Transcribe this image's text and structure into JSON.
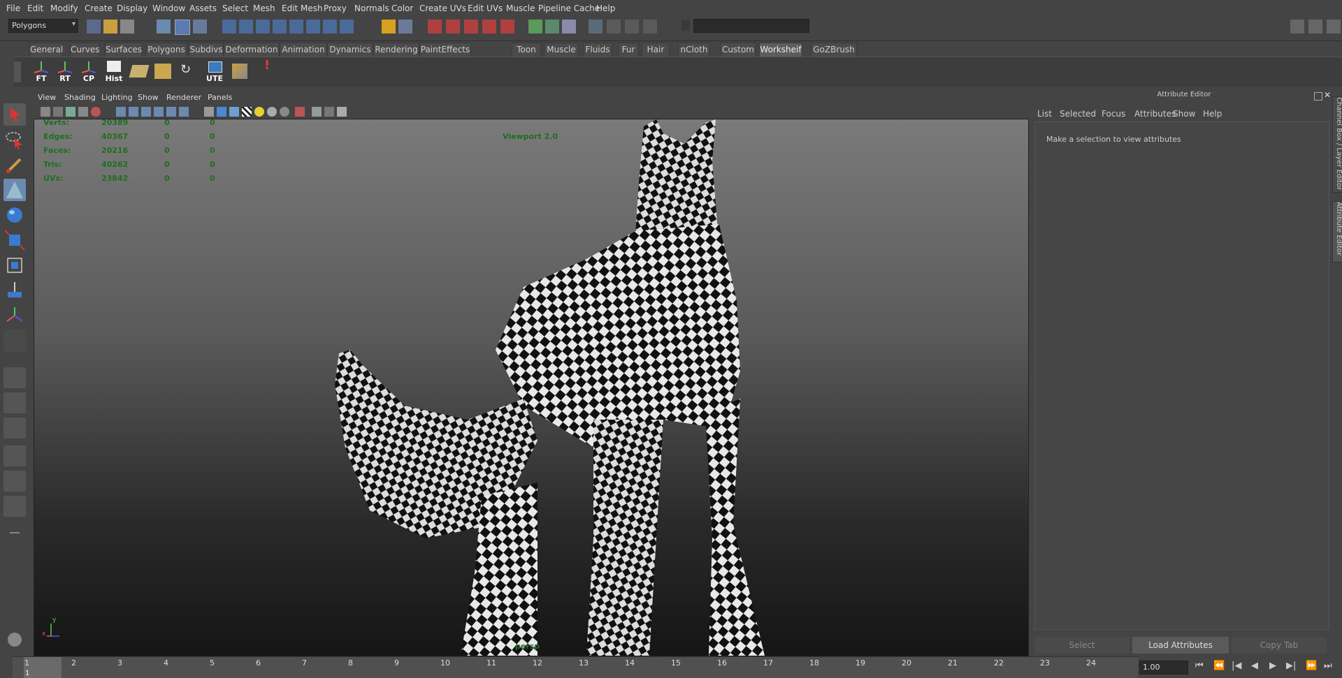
{
  "menubar": {
    "items": [
      "File",
      "Edit",
      "Modify",
      "Create",
      "Display",
      "Window",
      "Assets",
      "Select",
      "Mesh",
      "Edit Mesh",
      "Proxy",
      "Normals",
      "Color",
      "Create UVs",
      "Edit UVs",
      "Muscle",
      "Pipeline Cache",
      "Help"
    ]
  },
  "statusline": {
    "mode_select": "Polygons"
  },
  "shelf": {
    "tabs": [
      "General",
      "Curves",
      "Surfaces",
      "Polygons",
      "Subdivs",
      "Deformation",
      "Animation",
      "Dynamics",
      "Rendering",
      "PaintEffects",
      "Toon",
      "Muscle",
      "Fluids",
      "Fur",
      "Hair",
      "nCloth",
      "Custom",
      "Worksheif",
      "GoZBrush"
    ],
    "active_tab": "Worksheif",
    "buttons": [
      "FT",
      "RT",
      "CP",
      "Hist",
      "",
      "",
      "",
      "UTE",
      "",
      ""
    ]
  },
  "viewport": {
    "menu": [
      "View",
      "Shading",
      "Lighting",
      "Show",
      "Renderer",
      "Panels"
    ],
    "renderer_label": "Viewport 2.0",
    "camera_label": "persp",
    "hud": [
      {
        "label": "Verts:",
        "total": "20389",
        "a": "0",
        "b": "0"
      },
      {
        "label": "Edges:",
        "total": "40367",
        "a": "0",
        "b": "0"
      },
      {
        "label": "Faces:",
        "total": "20216",
        "a": "0",
        "b": "0"
      },
      {
        "label": "Tris:",
        "total": "40262",
        "a": "0",
        "b": "0"
      },
      {
        "label": "UVs:",
        "total": "23842",
        "a": "0",
        "b": "0"
      }
    ],
    "axis_x": "x",
    "axis_y": "y"
  },
  "attribute_editor": {
    "title": "Attribute Editor",
    "menu": [
      "List",
      "Selected",
      "Focus",
      "Attributes",
      "Show",
      "Help"
    ],
    "message": "Make a selection to view attributes",
    "select_button": "Select",
    "load_button": "Load Attributes",
    "copy_button": "Copy Tab"
  },
  "side_tabs": [
    "Channel Box / Layer Editor",
    "Attribute Editor"
  ],
  "timeslider": {
    "ticks": [
      "1",
      "2",
      "3",
      "4",
      "5",
      "6",
      "7",
      "8",
      "9",
      "10",
      "11",
      "12",
      "13",
      "14",
      "15",
      "16",
      "17",
      "18",
      "19",
      "20",
      "21",
      "22",
      "23",
      "24"
    ],
    "current_frame": "1",
    "current_time_field": "1.00"
  },
  "colors": {
    "hud_green": "#1f6e1f",
    "active_tab": "#5d5d5d",
    "load_button": "#5a5a5a"
  }
}
